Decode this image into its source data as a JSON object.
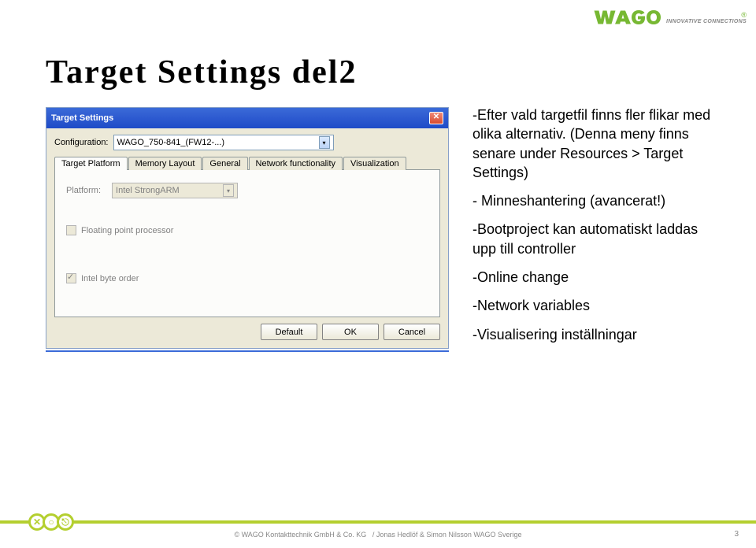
{
  "logo": {
    "text": "WAGO",
    "tagline": "INNOVATIVE CONNECTIONS",
    "reg": "®"
  },
  "title": "Target Settings del2",
  "dialog": {
    "title": "Target Settings",
    "config_label": "Configuration:",
    "config_value": "WAGO_750-841_(FW12-...)",
    "tabs": {
      "target_platform": "Target Platform",
      "memory_layout": "Memory Layout",
      "general": "General",
      "network": "Network functionality",
      "visualization": "Visualization"
    },
    "platform_label": "Platform:",
    "platform_value": "Intel StrongARM",
    "fpp_label": "Floating point processor",
    "ibo_label": "Intel byte order",
    "buttons": {
      "default": "Default",
      "ok": "OK",
      "cancel": "Cancel"
    }
  },
  "side": {
    "p1": "-Efter vald targetfil finns fler flikar med olika alternativ. (Denna meny finns senare under Resources > Target Settings)",
    "p2": "- Minneshantering (avancerat!)",
    "p3": "-Bootproject kan automatiskt laddas upp till controller",
    "p4": "-Online change",
    "p5": "-Network variables",
    "p6": "-Visualisering inställningar"
  },
  "footer": {
    "copy": "© WAGO Kontakttechnik GmbH & Co. KG",
    "author": "/ Jonas Hedlöf & Simon Nilsson WAGO Sverige",
    "page": "3"
  }
}
